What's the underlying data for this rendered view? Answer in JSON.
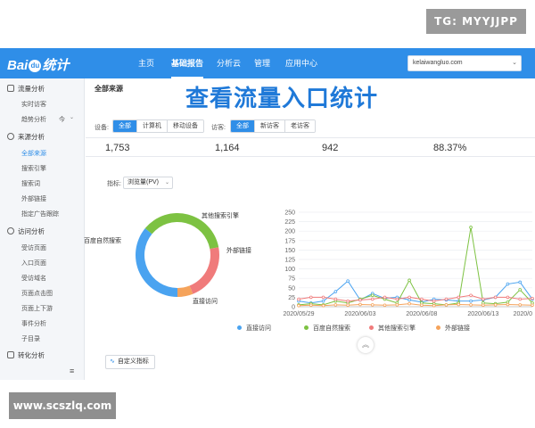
{
  "watermarks": {
    "top": "TG: MYYJJPP",
    "bottom": "www.scszlq.com"
  },
  "header": {
    "logo_text_left": "Bai",
    "logo_badge": "du",
    "logo_text_right": "统计",
    "nav": [
      "主页",
      "基础报告",
      "分析云",
      "管理",
      "应用中心"
    ],
    "active_nav": "基础报告",
    "domain": "kelaiwangluo.com"
  },
  "sidebar": {
    "groups": [
      {
        "label": "流量分析",
        "items": [
          "实时访客",
          "趋势分析"
        ]
      },
      {
        "label": "来源分析",
        "items": [
          "全部来源",
          "搜索引擎",
          "搜索词",
          "外部链接",
          "指定广告跟踪"
        ]
      },
      {
        "label": "访问分析",
        "items": [
          "受访页面",
          "入口页面",
          "受访域名",
          "页面点击图",
          "页面上下游",
          "事件分析",
          "子目录"
        ]
      },
      {
        "label": "转化分析",
        "items": []
      }
    ],
    "trend_tail": "今",
    "active_item": "全部来源"
  },
  "main": {
    "breadcrumb": "全部来源",
    "overlay_title": "查看流量入口统计",
    "device_label": "设备:",
    "device_options": [
      "全部",
      "计算机",
      "移动设备"
    ],
    "visitor_label": "访客:",
    "visitor_options": [
      "全部",
      "新访客",
      "老访客"
    ],
    "kpis": [
      "1,753",
      "1,164",
      "942",
      "88.37%"
    ],
    "metric_label": "指标:",
    "metric_value": "浏览量(PV)",
    "custom_button": "自定义指标"
  },
  "colors": {
    "direct": "#4aa3f0",
    "baidu": "#7dc242",
    "other_search": "#f07b7b",
    "external": "#f5a35b",
    "brand": "#2f8ee8"
  },
  "chart_data": [
    {
      "type": "pie",
      "labels": [
        "直接访问",
        "百度自然搜索",
        "其他搜索引擎",
        "外部链接"
      ],
      "values": [
        36,
        36,
        22,
        6
      ]
    },
    {
      "type": "line",
      "x": [
        "2020/05/29",
        "2020/05/30",
        "2020/05/31",
        "2020/06/01",
        "2020/06/02",
        "2020/06/03",
        "2020/06/04",
        "2020/06/05",
        "2020/06/06",
        "2020/06/07",
        "2020/06/08",
        "2020/06/09",
        "2020/06/10",
        "2020/06/11",
        "2020/06/12",
        "2020/06/13",
        "2020/06/14",
        "2020/06/15",
        "2020/06/16",
        "2020/06/17"
      ],
      "x_tick_labels": [
        "2020/05/29",
        "2020/06/03",
        "2020/06/08",
        "2020/06/13",
        "2020/0"
      ],
      "ylim": [
        0,
        250
      ],
      "y_ticks": [
        0,
        25,
        50,
        75,
        100,
        125,
        150,
        175,
        200,
        225,
        250
      ],
      "series": [
        {
          "name": "直接访问",
          "values": [
            15,
            10,
            15,
            40,
            68,
            18,
            35,
            22,
            25,
            18,
            12,
            20,
            18,
            15,
            15,
            18,
            25,
            60,
            65,
            20
          ]
        },
        {
          "name": "百度自然搜索",
          "values": [
            5,
            8,
            5,
            15,
            10,
            20,
            30,
            20,
            10,
            70,
            10,
            8,
            5,
            10,
            210,
            10,
            8,
            12,
            45,
            10
          ]
        },
        {
          "name": "其他搜索引擎",
          "values": [
            20,
            25,
            25,
            20,
            15,
            18,
            20,
            25,
            20,
            25,
            20,
            15,
            20,
            25,
            30,
            20,
            25,
            25,
            20,
            22
          ]
        },
        {
          "name": "外部链接",
          "values": [
            3,
            4,
            3,
            5,
            4,
            6,
            5,
            4,
            5,
            8,
            4,
            3,
            5,
            6,
            5,
            4,
            5,
            6,
            5,
            4
          ]
        }
      ]
    }
  ]
}
